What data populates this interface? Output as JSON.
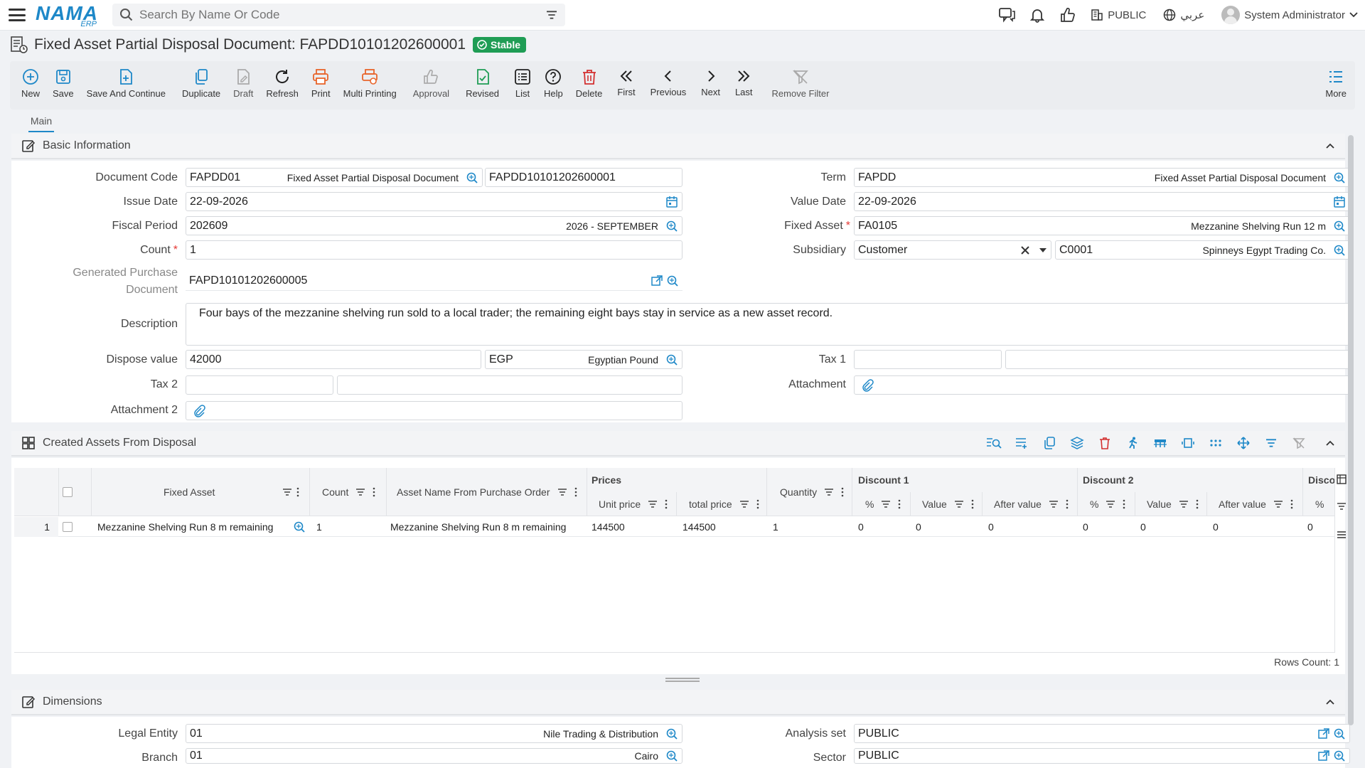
{
  "app": {
    "logo_main": "NAMA",
    "logo_sub": "ERP",
    "search_placeholder": "Search By Name Or Code",
    "company": "PUBLIC",
    "language": "عربي",
    "user": "System Administrator"
  },
  "document": {
    "title": "Fixed Asset Partial Disposal Document: FAPDD10101202600001",
    "status": "Stable"
  },
  "toolbar": [
    {
      "id": "new",
      "label": "New"
    },
    {
      "id": "save",
      "label": "Save"
    },
    {
      "id": "save-continue",
      "label": "Save And Continue"
    },
    {
      "id": "duplicate",
      "label": "Duplicate"
    },
    {
      "id": "draft",
      "label": "Draft"
    },
    {
      "id": "refresh",
      "label": "Refresh"
    },
    {
      "id": "print",
      "label": "Print"
    },
    {
      "id": "multi-print",
      "label": "Multi Printing"
    },
    {
      "id": "approval",
      "label": "Approval"
    },
    {
      "id": "revised",
      "label": "Revised"
    },
    {
      "id": "list",
      "label": "List"
    },
    {
      "id": "help",
      "label": "Help"
    },
    {
      "id": "delete",
      "label": "Delete"
    },
    {
      "id": "first",
      "label": "First"
    },
    {
      "id": "previous",
      "label": "Previous"
    },
    {
      "id": "next",
      "label": "Next"
    },
    {
      "id": "last",
      "label": "Last"
    },
    {
      "id": "remove-filter",
      "label": "Remove Filter"
    }
  ],
  "toolbar_more": "More",
  "tabs": {
    "main": "Main"
  },
  "basic": {
    "section_title": "Basic Information",
    "labels": {
      "document_code": "Document Code",
      "issue_date": "Issue Date",
      "fiscal_period": "Fiscal Period",
      "count": "Count",
      "generated_po_1": "Generated Purchase",
      "generated_po_2": "Document",
      "description": "Description",
      "dispose_value": "Dispose value",
      "tax2": "Tax 2",
      "attachment2": "Attachment 2",
      "term": "Term",
      "value_date": "Value Date",
      "fixed_asset": "Fixed Asset",
      "subsidiary": "Subsidiary",
      "tax1": "Tax 1",
      "attachment": "Attachment"
    },
    "values": {
      "document_code": "FAPDD01",
      "document_code_name": "Fixed Asset Partial Disposal Document",
      "document_number": "FAPDD10101202600001",
      "issue_date": "22-09-2026",
      "fiscal_period": "202609",
      "fiscal_period_name": "2026 - SEPTEMBER",
      "count": "1",
      "generated_po": "FAPD10101202600005",
      "description": "Four bays of the mezzanine shelving run sold to a local trader; the remaining eight bays stay in service as a new asset record.",
      "dispose_value": "42000",
      "currency_code": "EGP",
      "currency_name": "Egyptian Pound",
      "term": "FAPDD",
      "term_name": "Fixed Asset Partial Disposal Document",
      "value_date": "22-09-2026",
      "fixed_asset": "FA0105",
      "fixed_asset_name": "Mezzanine Shelving Run 12 m",
      "subsidiary_type": "Customer",
      "subsidiary_code": "C0001",
      "subsidiary_name": "Spinneys Egypt Trading Co."
    }
  },
  "grid": {
    "section_title": "Created Assets From Disposal",
    "headers": {
      "fixed_asset": "Fixed Asset",
      "count": "Count",
      "asset_name": "Asset Name From Purchase Order",
      "prices": "Prices",
      "unit_price": "Unit price",
      "total_price": "total price",
      "quantity": "Quantity",
      "discount1": "Discount 1",
      "discount2": "Discount 2",
      "discount3": "Disco",
      "pct": "%",
      "value": "Value",
      "after_value": "After value"
    },
    "rows": [
      {
        "num": "1",
        "fixed_asset": "Mezzanine Shelving Run 8 m remaining",
        "count": "1",
        "asset_name": "Mezzanine Shelving Run 8 m remaining",
        "unit_price": "144500",
        "total_price": "144500",
        "quantity": "1",
        "d1_pct": "0",
        "d1_value": "0",
        "d1_after": "0",
        "d2_pct": "0",
        "d2_value": "0",
        "d2_after": "0",
        "d3_pct": "0"
      }
    ],
    "rows_count": "Rows Count: 1"
  },
  "dimensions": {
    "section_title": "Dimensions",
    "labels": {
      "legal_entity": "Legal Entity",
      "branch": "Branch",
      "analysis_set": "Analysis set",
      "sector": "Sector"
    },
    "values": {
      "legal_entity": "01",
      "legal_entity_name": "Nile Trading & Distribution",
      "branch": "01",
      "branch_name": "Cairo",
      "analysis_set": "PUBLIC",
      "sector": "PUBLIC"
    }
  },
  "colors": {
    "brand": "#1e88c8",
    "stable_badge": "#1f9d55",
    "delete": "#d32f2f",
    "print": "#e8652b"
  }
}
